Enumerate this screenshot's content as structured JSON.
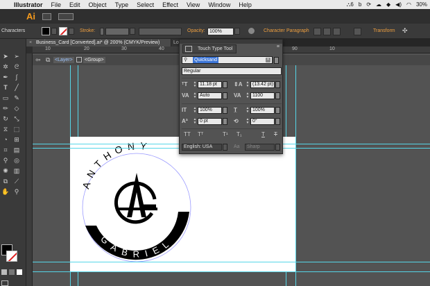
{
  "menubar": {
    "app_name": "Illustrator",
    "items": [
      "File",
      "Edit",
      "Object",
      "Type",
      "Select",
      "Effect",
      "View",
      "Window",
      "Help"
    ],
    "status": {
      "adobe_badge": "6",
      "battery": "30%"
    }
  },
  "appbar": {
    "logo": "Ai"
  },
  "controlbar": {
    "selection_label": "Characters",
    "stroke_label": "Stroke:",
    "opacity_label": "Opacity:",
    "opacity_value": "100%",
    "character_link": "Character",
    "paragraph_link": "Paragraph",
    "transform_link": "Transform",
    "accent_color": "#f0a040"
  },
  "document": {
    "tab_title": "Business_Card [Converted].ai* @ 200% (CMYK/Preview)",
    "second_tab": "Lo",
    "close_glyph": "×"
  },
  "rulers": {
    "h_ticks": [
      "10",
      "20",
      "30",
      "40",
      "90",
      "10"
    ]
  },
  "isolation": {
    "layer": "<Layer>",
    "group": "<Group>"
  },
  "character_panel": {
    "touch_type_label": "Touch Type Tool",
    "font_family": "Quicksand",
    "font_style": "Regular",
    "font_size": "11.18 pt",
    "leading": "(13.42 pt)",
    "kerning": "Auto",
    "tracking": "1100",
    "vertical_scale": "100%",
    "horizontal_scale": "100%",
    "baseline_shift": "0 pt",
    "rotation": "0°",
    "language": "English: USA",
    "anti_alias_label": "Aa",
    "anti_alias": "Sharp",
    "icons": [
      "size-icon",
      "leading-icon",
      "kerning-icon",
      "tracking-icon",
      "vertical-scale-icon",
      "horizontal-scale-icon",
      "baseline-icon",
      "rotation-icon"
    ],
    "text_styles": [
      "TT",
      "Tᵀ",
      "T¹",
      "T₁",
      "T",
      "T"
    ]
  },
  "artwork": {
    "top_text": "ANTHONY",
    "bottom_text": "GABRIEL",
    "monogram": [
      "A",
      "G"
    ]
  },
  "colors": {
    "guide": "#55d6e8",
    "selection_blue": "#3b74d6",
    "ai_orange": "#f59a1c"
  }
}
